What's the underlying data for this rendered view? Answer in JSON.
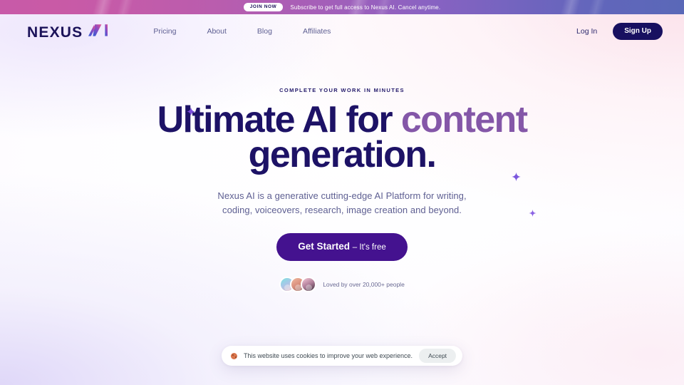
{
  "announcement": {
    "badge_label": "JOIN NOW",
    "text": "Subscribe to get full access to Nexus AI. Cancel anytime."
  },
  "header": {
    "logo": {
      "name_primary": "NEXUS",
      "name_accent": "AI"
    },
    "nav": [
      {
        "label": "Pricing"
      },
      {
        "label": "About"
      },
      {
        "label": "Blog"
      },
      {
        "label": "Affiliates"
      }
    ],
    "login_label": "Log In",
    "signup_label": "Sign Up"
  },
  "hero": {
    "eyebrow": "COMPLETE YOUR WORK IN MINUTES",
    "headline_line1_a": "Ultimate AI for ",
    "headline_line1_accent": "content",
    "headline_line2": "generation.",
    "subheading_line1": "Nexus AI is a generative cutting-edge AI Platform for writing,",
    "subheading_line2": "coding, voiceovers, research, image creation and beyond.",
    "cta_strong": "Get Started",
    "cta_light": "– It's free",
    "social_proof": "Loved by over 20,000+ people"
  },
  "cookie": {
    "text": "This website uses cookies to improve your web experience.",
    "accept_label": "Accept"
  },
  "colors": {
    "navy": "#1d1266",
    "accent_purple": "#8457a8",
    "cta_purple": "#44128f",
    "signup_navy": "#181060",
    "muted_text": "#5e5f92",
    "banner_pink": "#c85aa8",
    "banner_blue": "#5a68b8"
  }
}
